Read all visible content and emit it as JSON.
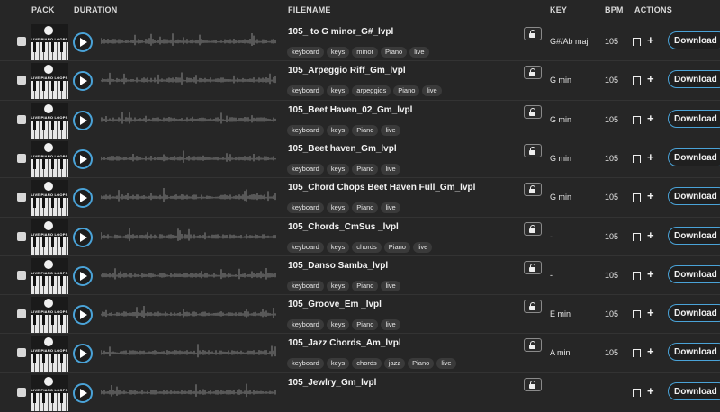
{
  "header": {
    "pack": "PACK",
    "duration": "DURATION",
    "filename": "FILENAME",
    "key": "KEY",
    "bpm": "BPM",
    "actions": "ACTIONS"
  },
  "thumb_title": "LIVE PIANO LOOPS",
  "download_label": "Download",
  "colors": {
    "accent": "#4aa3d8",
    "background": "#262626",
    "tag_bg": "#3a3a3a"
  },
  "rows": [
    {
      "filename": "105_ to G minor_G#_lvpl",
      "tags": [
        "keyboard",
        "keys",
        "minor",
        "Piano",
        "live"
      ],
      "key": "G#/Ab maj",
      "bpm": "105"
    },
    {
      "filename": "105_Arpeggio Riff_Gm_lvpl",
      "tags": [
        "keyboard",
        "keys",
        "arpeggios",
        "Piano",
        "live"
      ],
      "key": "G min",
      "bpm": "105"
    },
    {
      "filename": "105_Beet Haven_02_Gm_lvpl",
      "tags": [
        "keyboard",
        "keys",
        "Piano",
        "live"
      ],
      "key": "G min",
      "bpm": "105"
    },
    {
      "filename": "105_Beet haven_Gm_lvpl",
      "tags": [
        "keyboard",
        "keys",
        "Piano",
        "live"
      ],
      "key": "G min",
      "bpm": "105"
    },
    {
      "filename": "105_Chord Chops Beet Haven Full_Gm_lvpl",
      "tags": [
        "keyboard",
        "keys",
        "Piano",
        "live"
      ],
      "key": "G min",
      "bpm": "105"
    },
    {
      "filename": "105_Chords_CmSus _lvpl",
      "tags": [
        "keyboard",
        "keys",
        "chords",
        "Piano",
        "live"
      ],
      "key": "-",
      "bpm": "105"
    },
    {
      "filename": "105_Danso Samba_lvpl",
      "tags": [
        "keyboard",
        "keys",
        "Piano",
        "live"
      ],
      "key": "-",
      "bpm": "105"
    },
    {
      "filename": "105_Groove_Em _lvpl",
      "tags": [
        "keyboard",
        "keys",
        "Piano",
        "live"
      ],
      "key": "E min",
      "bpm": "105"
    },
    {
      "filename": "105_Jazz Chords_Am_lvpl",
      "tags": [
        "keyboard",
        "keys",
        "chords",
        "jazz",
        "Piano",
        "live"
      ],
      "key": "A min",
      "bpm": "105"
    },
    {
      "filename": "105_Jewlry_Gm_lvpl",
      "tags": [],
      "key": "",
      "bpm": ""
    }
  ]
}
